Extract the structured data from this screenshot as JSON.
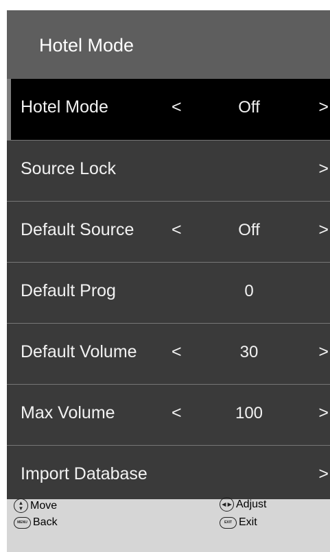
{
  "menu": {
    "title": "Hotel Mode",
    "items": [
      {
        "label": "Hotel Mode",
        "left_arrow": "<",
        "value": "Off",
        "right_arrow": ">"
      },
      {
        "label": "Source Lock",
        "left_arrow": "",
        "value": "",
        "right_arrow": ">"
      },
      {
        "label": "Default Source",
        "left_arrow": "<",
        "value": "Off",
        "right_arrow": ">"
      },
      {
        "label": "Default Prog",
        "left_arrow": "",
        "value": "0",
        "right_arrow": ""
      },
      {
        "label": "Default Volume",
        "left_arrow": "<",
        "value": "30",
        "right_arrow": ">"
      },
      {
        "label": "Max Volume",
        "left_arrow": "<",
        "value": "100",
        "right_arrow": ">"
      },
      {
        "label": "Import Database",
        "left_arrow": "",
        "value": "",
        "right_arrow": ">"
      }
    ]
  },
  "footer": {
    "move_label": "Move",
    "back_label": "Back",
    "adjust_label": "Adjust",
    "exit_label": "Exit",
    "menu_key_text": "MENU",
    "exit_key_text": "EXIT"
  },
  "colors": {
    "menu_background": "#3a3a3a",
    "header_background": "#5e5e5e",
    "selected_row": "#000000",
    "footer_background": "#d6d6d6"
  }
}
